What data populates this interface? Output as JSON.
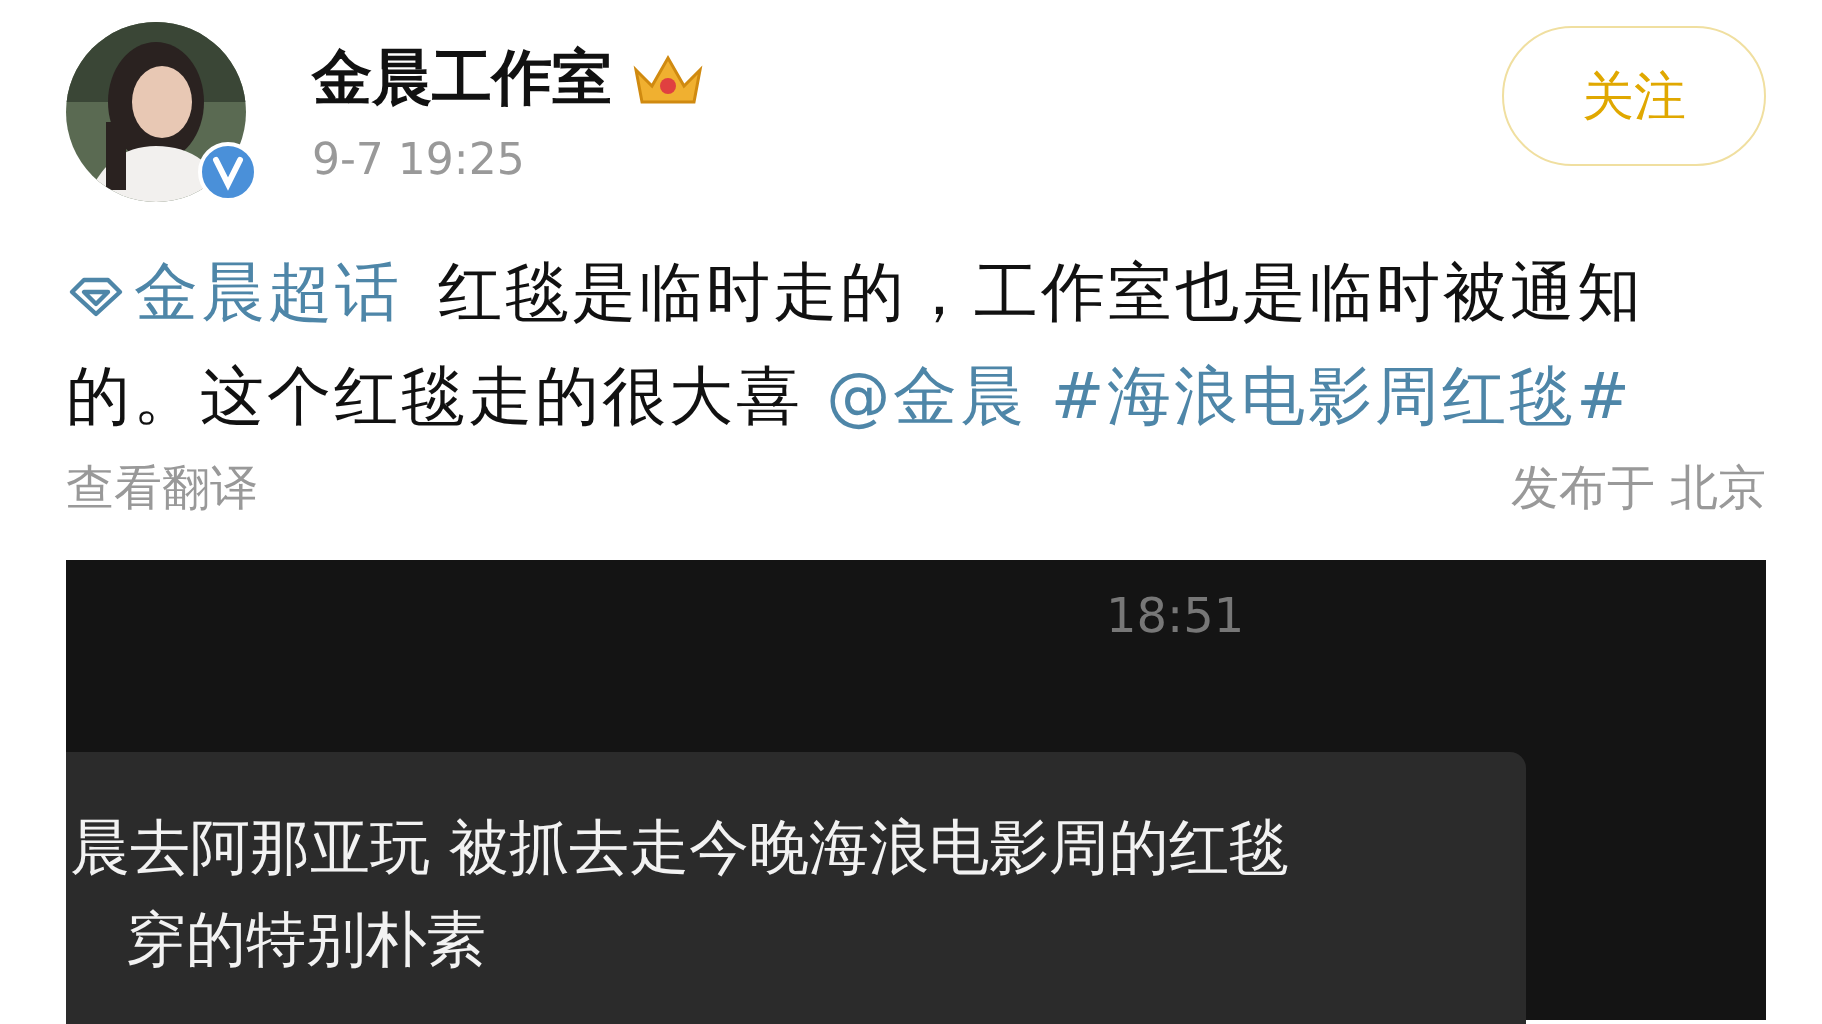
{
  "author": {
    "name": "金晨工作室",
    "verified": true,
    "time": "9-7 19:25"
  },
  "follow_button": {
    "label": "关注"
  },
  "post": {
    "segments": [
      {
        "kind": "topic",
        "text": "金晨超话"
      },
      {
        "kind": "text",
        "text": "红毯是临时走的，工作室也是临时被通知的。这个红毯走的很大喜"
      },
      {
        "kind": "mention",
        "text": "@金晨"
      },
      {
        "kind": "hashtag",
        "text": "#海浪电影周红毯#"
      }
    ],
    "translate_link": "查看翻译",
    "location": "发布于 北京"
  },
  "chat_screenshot": {
    "time": "18:51",
    "message_lines": [
      "晨去阿那亚玩  被抓去走今晚海浪电影周的红毯",
      "穿的特别朴素"
    ]
  }
}
